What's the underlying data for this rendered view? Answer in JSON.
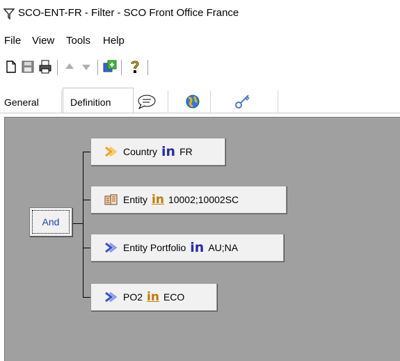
{
  "window": {
    "title": "SCO-ENT-FR - Filter - SCO Front Office France"
  },
  "menu": [
    "File",
    "View",
    "Tools",
    "Help"
  ],
  "toolbar": {
    "icons": [
      "new-document-icon",
      "save-icon",
      "print-icon",
      "arrow-up-icon",
      "arrow-down-icon",
      "refresh-icon",
      "help-icon"
    ]
  },
  "tabs": [
    {
      "label": "General",
      "active": false
    },
    {
      "label": "Definition",
      "active": true
    },
    {
      "label": "",
      "icon": "comment-icon"
    },
    {
      "label": "",
      "icon": "globe-icon"
    },
    {
      "label": "",
      "icon": "key-icon"
    }
  ],
  "tree": {
    "root": {
      "label": "And"
    },
    "conditions": [
      {
        "field": "Country",
        "operator": "in",
        "value": "FR",
        "icon": "dimension-icon"
      },
      {
        "field": "Entity",
        "operator": "in",
        "value": "10002;10002SC",
        "icon": "entity-icon"
      },
      {
        "field": "Entity Portfolio",
        "operator": "in",
        "value": "AU;NA",
        "icon": "portfolio-icon"
      },
      {
        "field": "PO2",
        "operator": "in",
        "value": "ECO",
        "icon": "portfolio-icon"
      }
    ]
  }
}
